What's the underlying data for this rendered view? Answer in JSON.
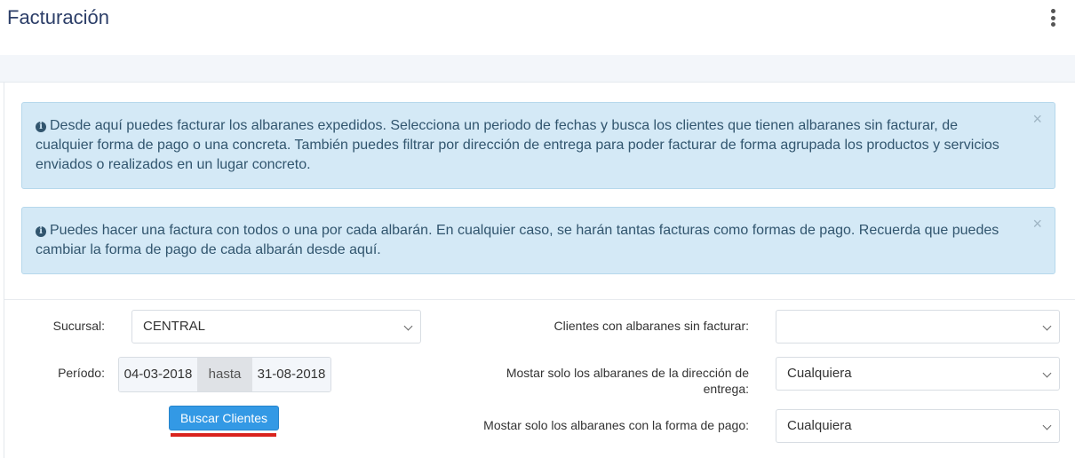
{
  "header": {
    "title": "Facturación"
  },
  "alerts": [
    {
      "text": "Desde aquí puedes facturar los albaranes expedidos. Selecciona un periodo de fechas y busca los clientes que tienen albaranes sin facturar, de cualquier forma de pago o una concreta. También puedes filtrar por dirección de entrega para poder facturar de forma agrupada los productos y servicios enviados o realizados en un lugar concreto.",
      "close": "×"
    },
    {
      "text": "Puedes hacer una factura con todos o una por cada albarán. En cualquier caso, se harán tantas facturas como formas de pago. Recuerda que puedes cambiar la forma de pago de cada albarán desde aquí.",
      "close": "×"
    }
  ],
  "form": {
    "branch_label": "Sucursal:",
    "branch_value": "CENTRAL",
    "period_label": "Período:",
    "date_from": "04-03-2018",
    "date_separator": "hasta",
    "date_to": "31-08-2018",
    "search_button": "Buscar Clientes",
    "clients_label": "Clientes con albaranes sin facturar:",
    "clients_value": "",
    "delivery_label": "Mostar solo los albaranes de la dirección de entrega:",
    "delivery_value": "Cualquiera",
    "payment_label": "Mostar solo los albaranes con la forma de pago:",
    "payment_value": "Cualquiera"
  },
  "colors": {
    "alert_bg": "#d4e9f6",
    "primary_button": "#3399e5",
    "highlight_underline": "#d9231d"
  }
}
